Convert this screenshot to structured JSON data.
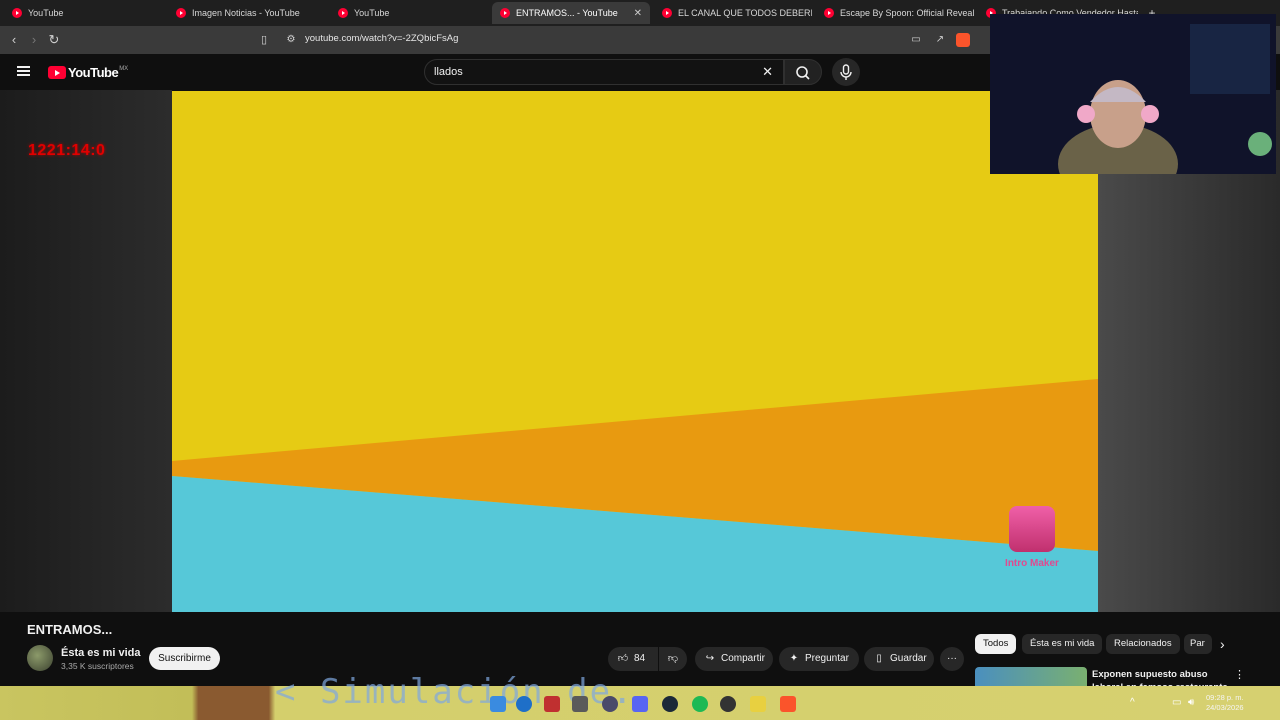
{
  "browser": {
    "tabs": [
      {
        "title": "YouTube",
        "active": false
      },
      {
        "title": "Imagen Noticias - YouTube",
        "active": false
      },
      {
        "title": "YouTube",
        "active": false
      },
      {
        "title": "ENTRAMOS... - YouTube",
        "active": true
      },
      {
        "title": "EL CANAL QUE TODOS DEBERIAMOS",
        "active": false
      },
      {
        "title": "Escape By Spoon: Official Reveal Trai",
        "active": false
      },
      {
        "title": "Trabajando Como Vendedor Hasta C",
        "active": false
      }
    ],
    "url": "youtube.com/watch?v=-2ZQbicFsAg"
  },
  "youtube": {
    "logo_text": "YouTube",
    "logo_region": "MX",
    "search_value": "llados"
  },
  "overlay": {
    "timer": "1221:14:0",
    "intro_maker_label": "Intro Maker",
    "banner_text": "< Simulación de..."
  },
  "video": {
    "title": "ENTRAMOS...",
    "channel": "Ésta es mi vida",
    "subscribers": "3,35 K suscriptores",
    "subscribe_label": "Suscribirme",
    "like_count": "84",
    "share_label": "Compartir",
    "ask_label": "Preguntar",
    "save_label": "Guardar"
  },
  "recommendations": {
    "chips": [
      "Todos",
      "Ésta es mi vida",
      "Relacionados",
      "Par"
    ],
    "first_title": "Exponen supuesto abuso laboral en famoso restaurante"
  },
  "taskbar": {
    "time": "09:28 p. m.",
    "date": "24/03/2026"
  },
  "colors": {
    "youtube_red": "#ff0033",
    "video_yellow": "#e6cb14",
    "video_orange": "#e89a10",
    "video_cyan": "#56c8d8",
    "timer_red": "#e00000"
  }
}
